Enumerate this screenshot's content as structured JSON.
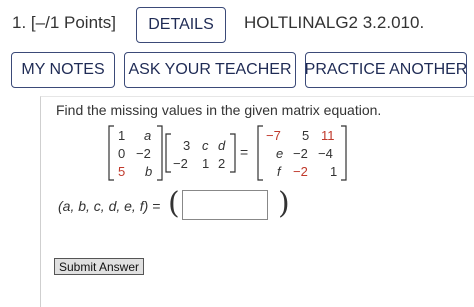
{
  "header": {
    "question_number": "1.",
    "points": "[–/1 Points]",
    "details_label": "DETAILS",
    "question_id": "HOLTLINALG2 3.2.010."
  },
  "actions": {
    "my_notes": "MY NOTES",
    "ask_teacher": "ASK YOUR TEACHER",
    "practice_another": "PRACTICE ANOTHER"
  },
  "question": {
    "prompt": "Find the missing values in the given matrix equation.",
    "matrix_a": [
      [
        "1",
        "a"
      ],
      [
        "0",
        "−2"
      ],
      [
        "5",
        "b"
      ]
    ],
    "matrix_b": [
      [
        "3",
        "c",
        "d"
      ],
      [
        "−2",
        "1",
        "2"
      ]
    ],
    "matrix_c": [
      [
        "−7",
        "5",
        "11"
      ],
      [
        "e",
        "−2",
        "−4"
      ],
      [
        "f",
        "−2",
        "1"
      ]
    ],
    "equals": "=",
    "answer_label": "(a, b, c, d, e, f) =",
    "answer_value": "",
    "open_paren": "(",
    "close_paren": ")"
  },
  "submit_label": "Submit Answer",
  "colors": {
    "highlight_red": "#c0392b",
    "button_border": "#3b4a78"
  }
}
